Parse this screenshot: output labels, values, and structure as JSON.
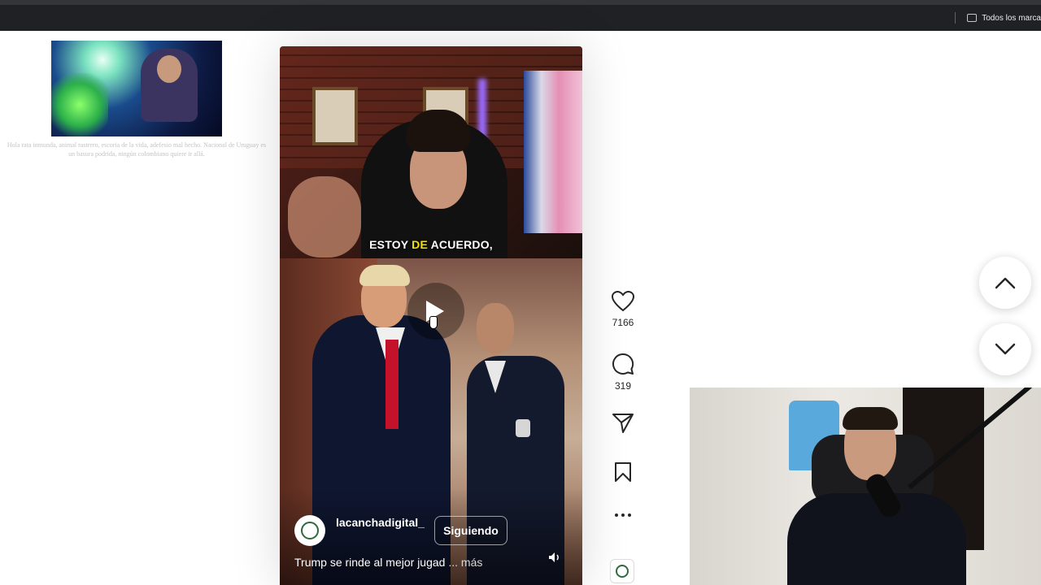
{
  "browser": {
    "bookmarks_label": "Todos los marca"
  },
  "left_panel": {
    "caption": "Hola rata inmunda, animal rastrero, escoria de la vida, adefesio mal hecho. Nacional de Uruguay es un basura podrida, ningún colombiano quiere ir allá."
  },
  "reel": {
    "subtitle_pre": "ESTOY ",
    "subtitle_highlight": "DE",
    "subtitle_post": " ACUERDO,",
    "username": "lacanchadigital_",
    "follow_label": "Siguiendo",
    "description": "Trump se rinde al mejor jugad",
    "more_label": "... más"
  },
  "actions": {
    "likes": "7166",
    "comments": "319"
  },
  "icons": {
    "heart": "heart-icon",
    "comment": "comment-icon",
    "share": "share-icon",
    "save": "bookmark-icon",
    "more": "more-icon",
    "up": "chevron-up-icon",
    "down": "chevron-down-icon",
    "volume": "volume-icon",
    "folder": "folder-icon"
  },
  "colors": {
    "subtitle_highlight": "#f5e400",
    "text_dark": "#262626"
  }
}
